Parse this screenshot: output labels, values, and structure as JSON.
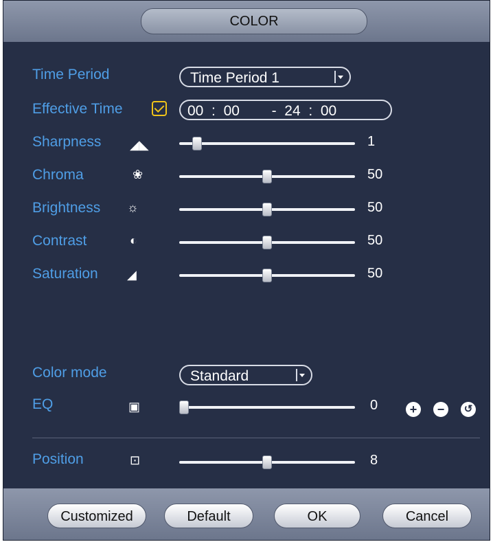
{
  "title": "COLOR",
  "time_period": {
    "label": "Time Period",
    "value": "Time Period 1"
  },
  "effective_time": {
    "label": "Effective Time",
    "checked": true,
    "start_hh": "00",
    "start_mm": "00",
    "end_hh": "24",
    "end_mm": "00"
  },
  "sliders": [
    {
      "id": "sharpness",
      "label": "Sharpness",
      "icon": "sharpness-icon",
      "value": "1",
      "fraction": 0.08
    },
    {
      "id": "chroma",
      "label": "Chroma",
      "icon": "chroma-icon",
      "value": "50",
      "fraction": 0.5
    },
    {
      "id": "brightness",
      "label": "Brightness",
      "icon": "brightness-icon",
      "value": "50",
      "fraction": 0.5
    },
    {
      "id": "contrast",
      "label": "Contrast",
      "icon": "contrast-icon",
      "value": "50",
      "fraction": 0.5
    },
    {
      "id": "saturation",
      "label": "Saturation",
      "icon": "saturation-icon",
      "value": "50",
      "fraction": 0.5
    }
  ],
  "color_mode": {
    "label": "Color mode",
    "value": "Standard"
  },
  "eq": {
    "label": "EQ",
    "icon": "eq-icon",
    "value": "0",
    "fraction": 0.0
  },
  "position": {
    "label": "Position",
    "icon": "position-icon",
    "value": "8",
    "fraction": 0.5
  },
  "buttons": {
    "customized": "Customized",
    "default": "Default",
    "ok": "OK",
    "cancel": "Cancel"
  },
  "colors": {
    "label_blue": "#4f9ee6",
    "background": "#262f46",
    "check_yellow": "#f0c419"
  }
}
